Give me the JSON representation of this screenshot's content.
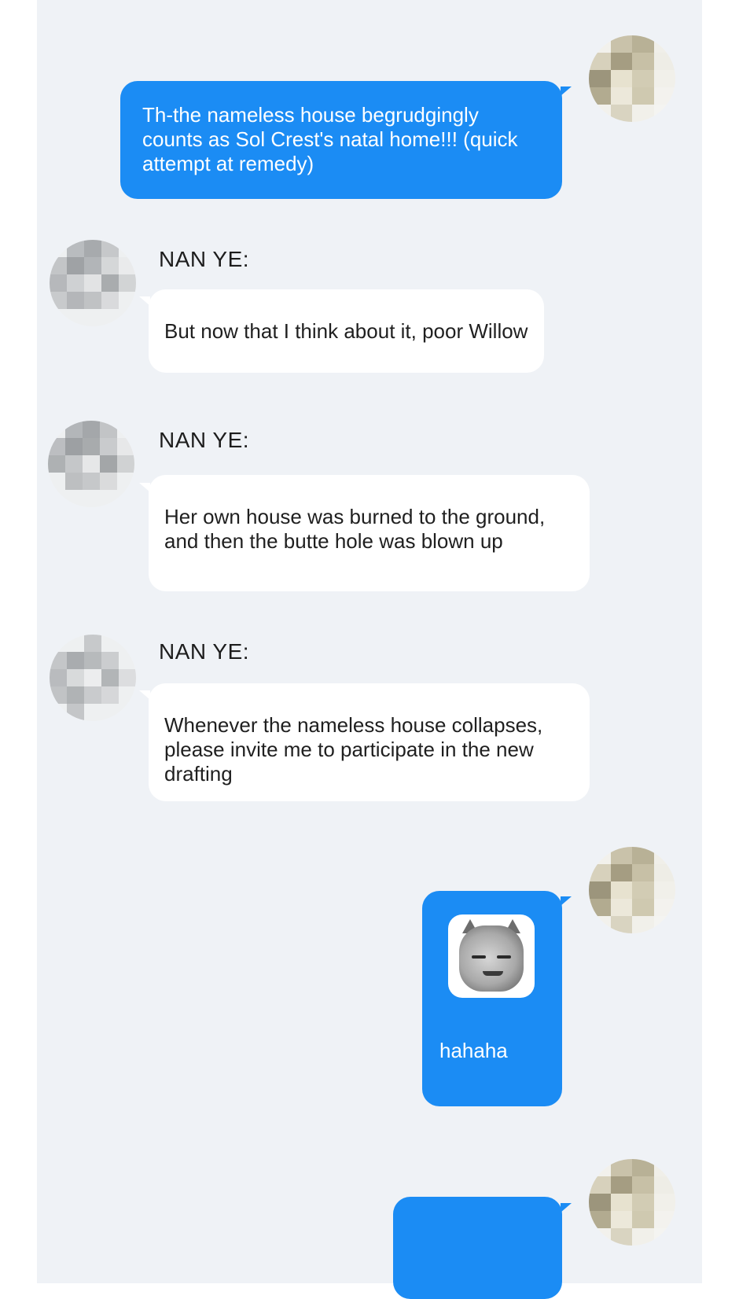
{
  "chat": {
    "messages": [
      {
        "side": "out",
        "text": "Th-the nameless house begrudgingly counts as Sol Crest's natal home!!! (quick attempt at remedy)"
      },
      {
        "side": "in",
        "sender": "NAN YE:",
        "text": "But now that I think about it, poor Willow"
      },
      {
        "side": "in",
        "sender": "NAN YE:",
        "text": "Her own house was burned to the ground, and then the butte hole was blown up"
      },
      {
        "side": "in",
        "sender": "NAN YE:",
        "text": "Whenever the nameless house collapses, please invite me to participate in the new drafting"
      },
      {
        "side": "out",
        "sticker": "meme-face-sticker",
        "text": "hahaha"
      },
      {
        "side": "out",
        "text": ""
      }
    ]
  },
  "colors": {
    "background": "#eff2f6",
    "outgoing_bubble": "#1b8cf4",
    "incoming_bubble": "#ffffff"
  }
}
